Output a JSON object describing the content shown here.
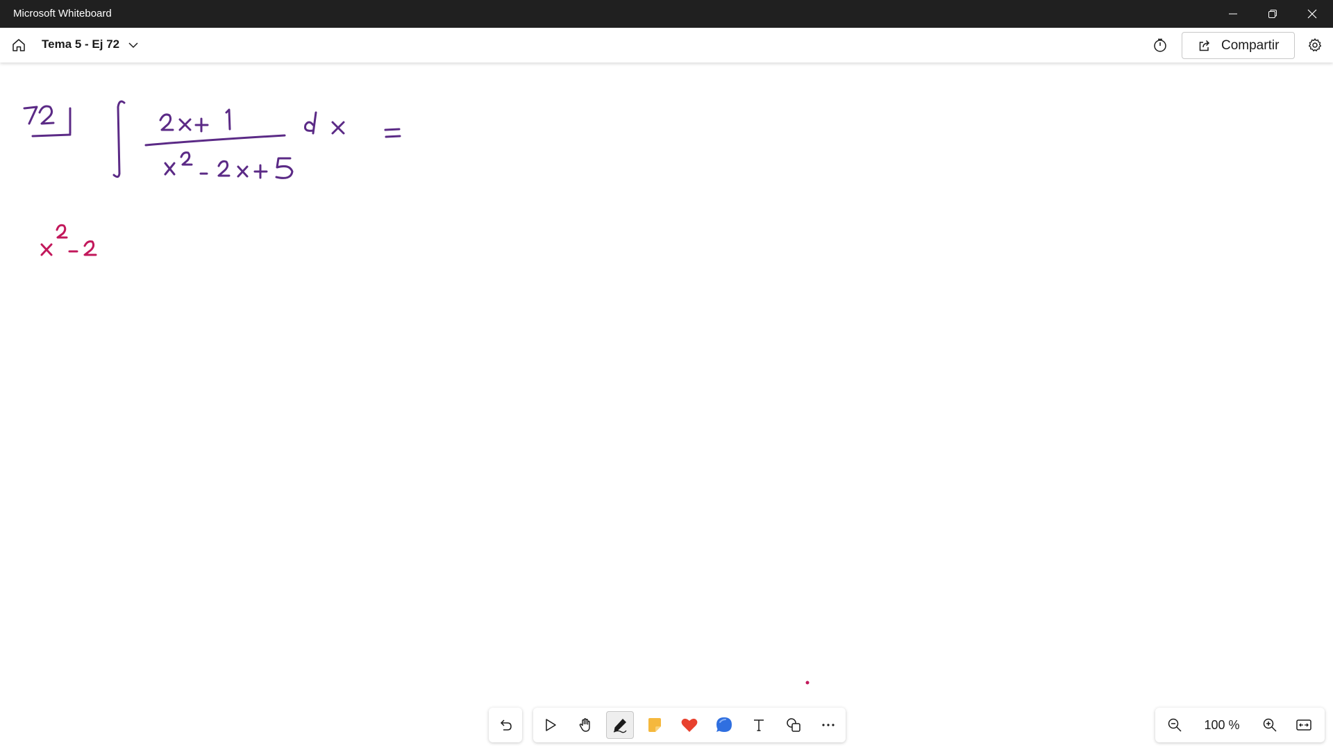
{
  "window": {
    "title": "Microsoft Whiteboard",
    "controls": [
      "minimize-icon",
      "restore-icon",
      "close-icon"
    ]
  },
  "toolbar": {
    "home_icon": "home-icon",
    "board_title": "Tema 5 - Ej 72",
    "dropdown_icon": "chevron-down-icon",
    "timer_icon": "timer-icon",
    "share_label": "Compartir",
    "share_icon": "share-icon",
    "settings_icon": "gear-icon"
  },
  "canvas": {
    "ink_colors": {
      "purple": "#5b2a86",
      "crimson": "#c2185b"
    },
    "handwriting": {
      "exercise_number": "72",
      "integral": "∫ (2x + 1) / (x² − 2x + 5) dx =",
      "note": "x² − 2"
    }
  },
  "bottom_toolbar": {
    "undo_icon": "undo-icon",
    "tools": [
      {
        "name": "select",
        "icon": "pointer-icon"
      },
      {
        "name": "pan",
        "icon": "hand-icon"
      },
      {
        "name": "pen",
        "icon": "pen-icon",
        "active": true
      },
      {
        "name": "sticky-note",
        "icon": "sticky-note-icon"
      },
      {
        "name": "reactions",
        "icon": "heart-icon"
      },
      {
        "name": "comment",
        "icon": "comment-icon"
      },
      {
        "name": "text",
        "icon": "text-icon"
      },
      {
        "name": "shapes",
        "icon": "shapes-icon"
      },
      {
        "name": "more",
        "icon": "more-icon"
      }
    ]
  },
  "zoom": {
    "level": "100 %",
    "zoom_out_icon": "zoom-out-icon",
    "zoom_in_icon": "zoom-in-icon",
    "fit_icon": "fit-to-screen-icon"
  },
  "colors": {
    "titlebar": "#202020",
    "sticky_note": "#f5b83d",
    "heart": "#e8412e",
    "comment": "#2f6fe0"
  }
}
